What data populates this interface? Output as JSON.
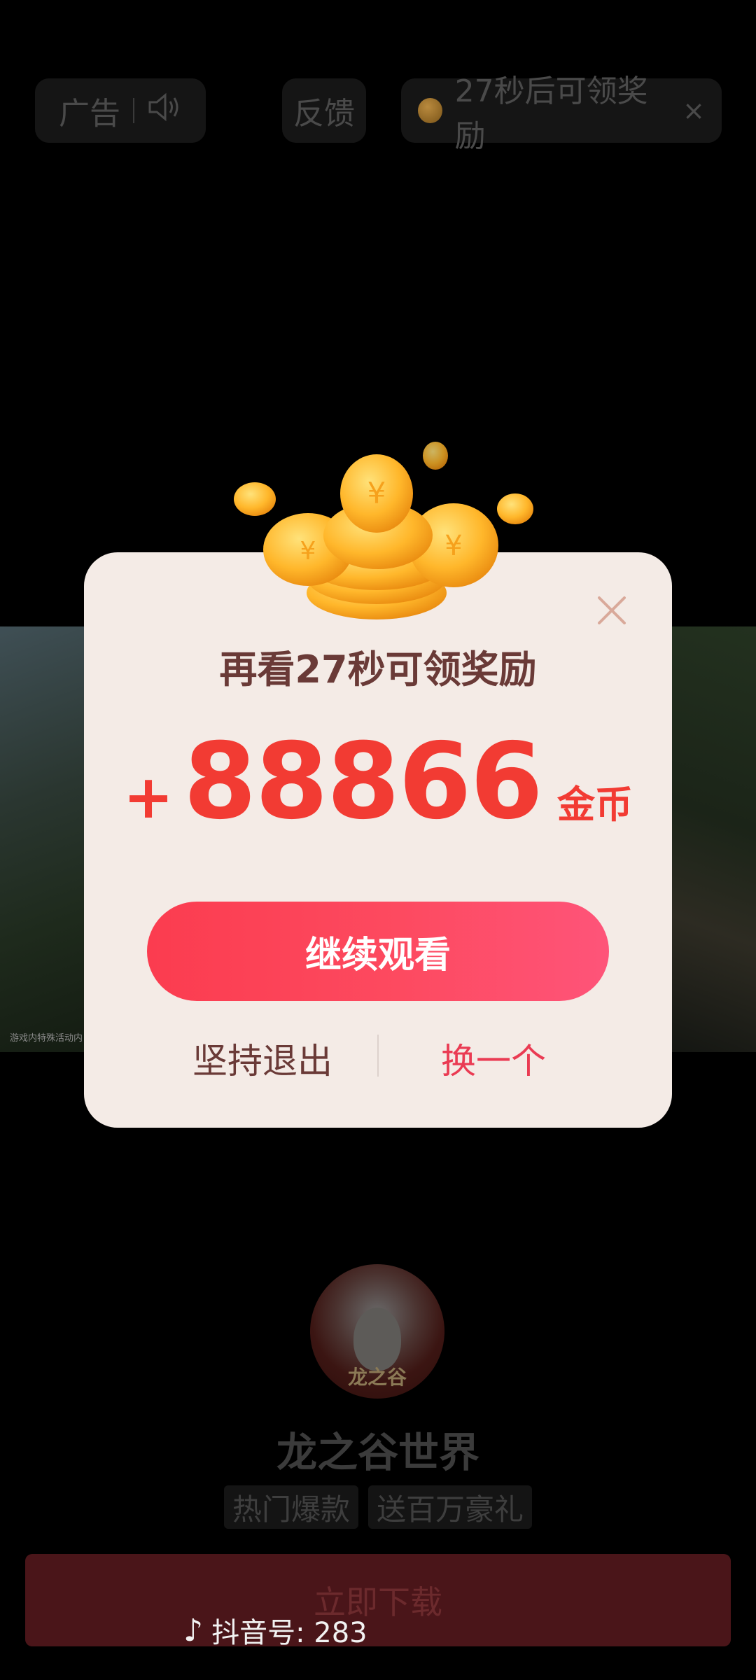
{
  "top_bar": {
    "ad_label": "广告",
    "feedback_label": "反馈",
    "reward_countdown": "27秒后可领奖励",
    "close_symbol": "×"
  },
  "video": {
    "watermark": "游戏内特殊活动内"
  },
  "dialog": {
    "title": "再看27秒可领奖励",
    "reward_plus": "+",
    "reward_amount": "88866",
    "reward_unit": "金币",
    "continue_label": "继续观看",
    "quit_label": "坚持退出",
    "switch_label": "换一个"
  },
  "app": {
    "icon_text": "龙之谷",
    "name": "龙之谷世界",
    "tags": [
      "热门爆款",
      "送百万豪礼"
    ],
    "download_label": "立即下载"
  },
  "overlay": {
    "douyin_id": "抖音号: 283"
  },
  "colors": {
    "accent_red": "#f23b33",
    "button_gradient_start": "#fb3c4f",
    "button_gradient_end": "#fe5479",
    "dialog_bg": "#f4ebe6",
    "title_brown": "#6a3a37",
    "switch_pink": "#ea3b53"
  },
  "icons": [
    "speaker-icon",
    "coin-icon",
    "close-icon",
    "gold-coins-icon",
    "tiktok-icon"
  ]
}
